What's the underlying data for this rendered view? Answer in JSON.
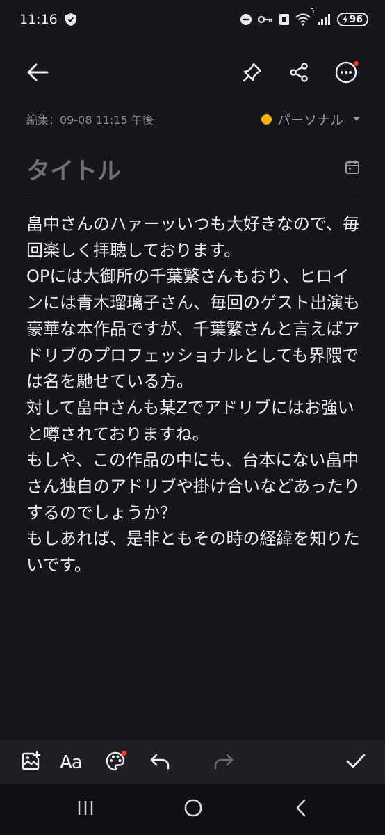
{
  "status_bar": {
    "time": "11:16",
    "battery": "96",
    "network_sup": "5"
  },
  "note": {
    "edited": "編集：09-08 11:15 午後",
    "category": "パーソナル",
    "category_color": "#f6b400",
    "title_placeholder": "タイトル",
    "body": "畠中さんのハァーッいつも大好きなので、毎回楽しく拝聴しております。\nOPには大御所の千葉繁さんもおり、ヒロインには青木瑠璃子さん、毎回のゲスト出演も豪華な本作品ですが、千葉繁さんと言えばアドリブのプロフェッショナルとしても界隈では名を馳せている方。\n対して畠中さんも某Zでアドリブにはお強いと噂されておりますね。\nもしや、この作品の中にも、台本にない畠中さん独自のアドリブや掛け合いなどあったりするのでしょうか？\nもしあれば、是非ともその時の経緯を知りたいです。"
  },
  "bottom_toolbar": {
    "text_style_label": "Aa"
  },
  "icons": [
    "back-arrow-icon",
    "pin-icon",
    "share-icon",
    "more-icon",
    "calendar-icon",
    "insert-image-icon",
    "palette-icon",
    "undo-icon",
    "redo-icon",
    "check-icon"
  ],
  "colors": {
    "background": "#16171b",
    "notification_dot": "#ff3b30"
  }
}
